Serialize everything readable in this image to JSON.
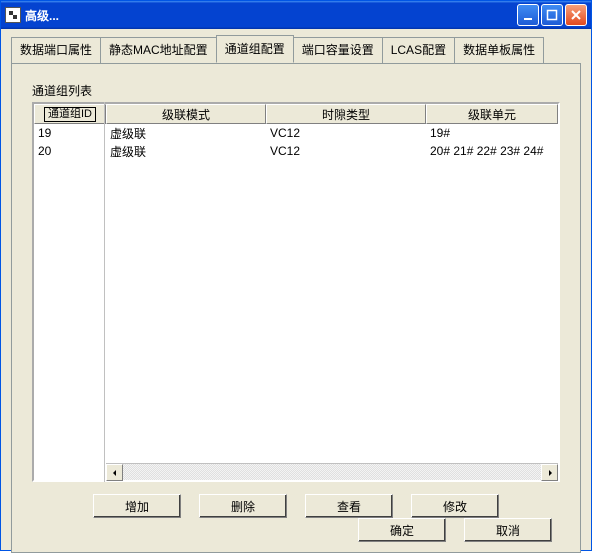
{
  "window": {
    "title": "高级..."
  },
  "tabs": [
    {
      "label": "数据端口属性",
      "active": false
    },
    {
      "label": "静态MAC地址配置",
      "active": false
    },
    {
      "label": "通道组配置",
      "active": true
    },
    {
      "label": "端口容量设置",
      "active": false
    },
    {
      "label": "LCAS配置",
      "active": false
    },
    {
      "label": "数据单板属性",
      "active": false
    }
  ],
  "list_label": "通道组列表",
  "columns": {
    "id": "通道组ID",
    "mode": "级联模式",
    "slot": "时隙类型",
    "unit": "级联单元"
  },
  "rows": [
    {
      "id": "19",
      "mode": "虚级联",
      "slot": "VC12",
      "unit": "19#"
    },
    {
      "id": "20",
      "mode": "虚级联",
      "slot": "VC12",
      "unit": "20# 21# 22# 23# 24#"
    }
  ],
  "actions": {
    "add": "增加",
    "delete": "删除",
    "view": "查看",
    "modify": "修改"
  },
  "dialog": {
    "ok": "确定",
    "cancel": "取消"
  }
}
